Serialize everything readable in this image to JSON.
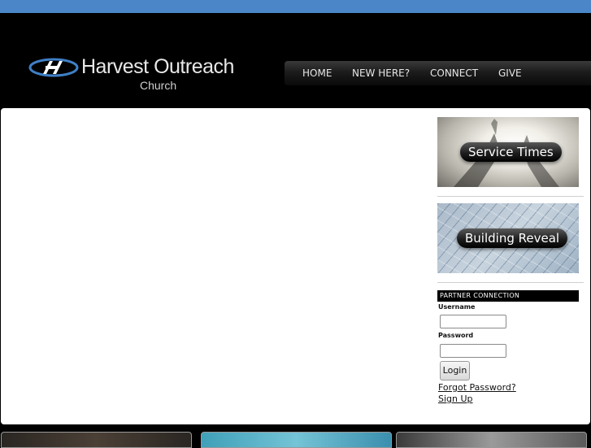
{
  "brand": {
    "title": "Harvest Outreach",
    "subtitle": "Church"
  },
  "nav": {
    "items": [
      "HOME",
      "NEW HERE?",
      "CONNECT",
      "GIVE"
    ]
  },
  "sidebar": {
    "service_times_label": "Service Times",
    "building_reveal_label": "Building Reveal",
    "partner_connection": {
      "header": "PARTNER CONNECTION",
      "username_label": "Username",
      "username_value": "",
      "password_label": "Password",
      "password_value": "",
      "login_label": "Login",
      "forgot_password": "Forgot Password?",
      "sign_up": "Sign Up"
    }
  },
  "colors": {
    "top_bar": "#4a86c8",
    "header_bg": "#000000",
    "content_bg": "#ffffff"
  }
}
